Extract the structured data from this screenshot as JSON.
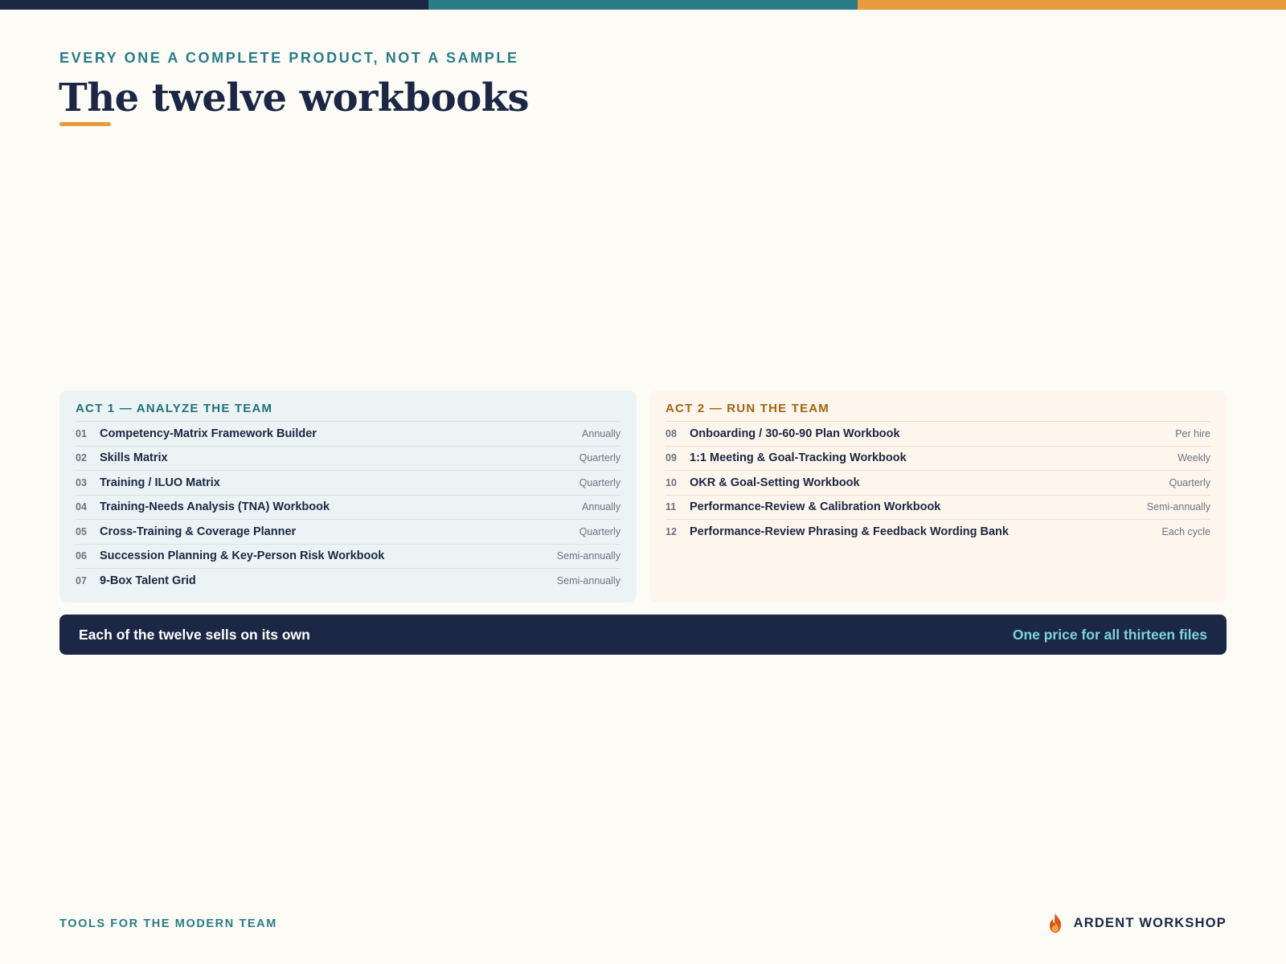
{
  "colors": {
    "navy": "#1b2744",
    "teal": "#2a7c88",
    "orange": "#e89a3c",
    "cream": "#fcfbf6",
    "banner_accent": "#7dd2dd"
  },
  "header": {
    "eyebrow": "EVERY ONE A COMPLETE PRODUCT, NOT A SAMPLE",
    "title": "The twelve workbooks"
  },
  "act1": {
    "title": "ACT 1 — ANALYZE THE TEAM",
    "items": [
      {
        "num": "01",
        "name": "Competency-Matrix Framework Builder",
        "freq": "Annually"
      },
      {
        "num": "02",
        "name": "Skills Matrix",
        "freq": "Quarterly"
      },
      {
        "num": "03",
        "name": "Training / ILUO Matrix",
        "freq": "Quarterly"
      },
      {
        "num": "04",
        "name": "Training-Needs Analysis (TNA) Workbook",
        "freq": "Annually"
      },
      {
        "num": "05",
        "name": "Cross-Training & Coverage Planner",
        "freq": "Quarterly"
      },
      {
        "num": "06",
        "name": "Succession Planning & Key-Person Risk Workbook",
        "freq": "Semi-annually"
      },
      {
        "num": "07",
        "name": "9-Box Talent Grid",
        "freq": "Semi-annually"
      }
    ]
  },
  "act2": {
    "title": "ACT 2 — RUN THE TEAM",
    "items": [
      {
        "num": "08",
        "name": "Onboarding / 30-60-90 Plan Workbook",
        "freq": "Per hire"
      },
      {
        "num": "09",
        "name": "1:1 Meeting & Goal-Tracking Workbook",
        "freq": "Weekly"
      },
      {
        "num": "10",
        "name": "OKR & Goal-Setting Workbook",
        "freq": "Quarterly"
      },
      {
        "num": "11",
        "name": "Performance-Review & Calibration Workbook",
        "freq": "Semi-annually"
      },
      {
        "num": "12",
        "name": "Performance-Review Phrasing & Feedback Wording Bank",
        "freq": "Each cycle"
      }
    ]
  },
  "banner": {
    "left": "Each of the twelve sells on its own",
    "right": "One price for all thirteen files"
  },
  "footer": {
    "tagline": "TOOLS FOR THE MODERN TEAM",
    "brand": "ARDENT WORKSHOP",
    "brand_icon": "flame-icon"
  }
}
